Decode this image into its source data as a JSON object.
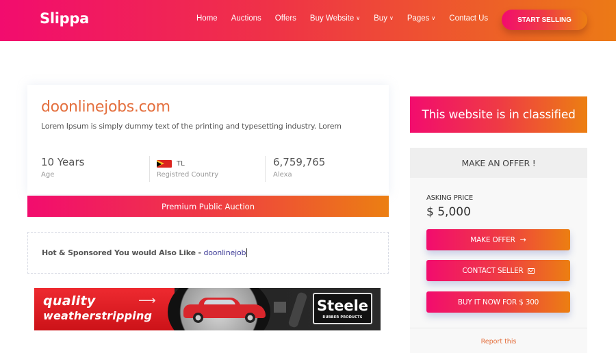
{
  "header": {
    "logo": "Slippa",
    "nav": [
      {
        "label": "Home",
        "dropdown": false
      },
      {
        "label": "Auctions",
        "dropdown": false
      },
      {
        "label": "Offers",
        "dropdown": false
      },
      {
        "label": "Buy Website",
        "dropdown": true
      },
      {
        "label": "Buy",
        "dropdown": true
      },
      {
        "label": "Pages",
        "dropdown": true
      },
      {
        "label": "Contact Us",
        "dropdown": false
      }
    ],
    "cta_label": "START SELLING",
    "chevron": "⌄"
  },
  "listing": {
    "domain": "doonlinejobs.com",
    "description": "Lorem Ipsum is simply dummy text of the printing and typesetting industry. Lorem",
    "stats": {
      "age_value": "10 Years",
      "age_label": "Age",
      "country_code": "TL",
      "country_label": "Registred Country",
      "alexa_value": "6,759,765",
      "alexa_label": "Alexa"
    },
    "auction_type": "Premium Public Auction"
  },
  "sponsored": {
    "text": "Hot & Sponsored You would Also Like - ",
    "link": "doonlinejob"
  },
  "banner_ad": {
    "line1": "quality",
    "line2": "weatherstripping",
    "arrow": "⟶",
    "brand": "Steele",
    "brand_sub": "RUBBER PRODUCTS"
  },
  "sidebar": {
    "classified_text": "This website is in classified",
    "offer_header": "MAKE AN OFFER !",
    "asking_label": "ASKING PRICE",
    "asking_value": "$ 5,000",
    "make_offer_label": "MAKE OFFER",
    "make_offer_icon": "→",
    "contact_label": "CONTACT SELLER",
    "buy_now_label": "BUY IT NOW FOR $ 300",
    "report_label": "Report this"
  },
  "colors": {
    "gradient_start": "#f20c6e",
    "gradient_end": "#ec7f12",
    "domain_color": "#e46f3d",
    "link_color": "#3c3a96"
  }
}
